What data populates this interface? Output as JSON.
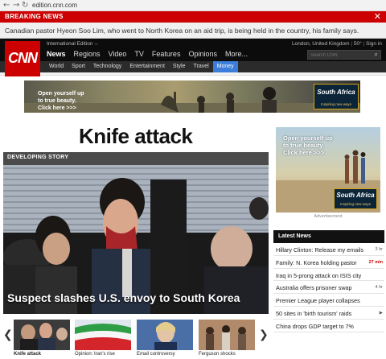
{
  "browser": {
    "back": "←",
    "forward": "→",
    "reload": "↻",
    "url": "edition.cnn.com"
  },
  "breaking": {
    "label": "BREAKING NEWS",
    "close": "✕",
    "text": "Canadian pastor Hyeon Soo Lim, who went to North Korea on an aid trip, is being held in the country, his family says."
  },
  "header": {
    "logo": "CNN",
    "edition": "International Edition ⌵",
    "location": "London, United Kingdom",
    "temp": "50°",
    "signin": "Sign in",
    "search_placeholder": "Search CNN",
    "search_icon": "search-icon",
    "nav": [
      "News",
      "Regions",
      "Video",
      "TV",
      "Features",
      "Opinions",
      "More..."
    ],
    "subnav": [
      "World",
      "Sport",
      "Technology",
      "Entertainment",
      "Style",
      "Travel",
      "Money"
    ]
  },
  "ad_top": {
    "text": "Open yourself up\nto true beauty.\nClick here >>>",
    "brand": "South Africa",
    "tagline": "Inspiring new ways"
  },
  "main": {
    "headline": "Knife attack",
    "story_label": "DEVELOPING STORY",
    "caption": "Suspect slashes U.S. envoy to South Korea"
  },
  "ad_right": {
    "text": "Open yourself up\nto true beauty.\nClick here >>>",
    "brand": "South Africa",
    "tagline": "Inspiring new ways",
    "label": "Advertisement"
  },
  "latest": {
    "title": "Latest News",
    "items": [
      {
        "text": "Hillary Clinton: Release my emails",
        "meta": "3 hr"
      },
      {
        "text": "Family: N. Korea holding pastor",
        "meta": "27 min"
      },
      {
        "text": "Iraq in 5-prong attack on ISIS city",
        "meta": ""
      },
      {
        "text": "Australia offers prisoner swap",
        "meta": "4 hr"
      },
      {
        "text": "Premier League player collapses",
        "meta": ""
      },
      {
        "text": "50 sites in 'birth tourism' raids",
        "meta": "▶"
      },
      {
        "text": "China drops GDP target to 7%",
        "meta": ""
      }
    ]
  },
  "carousel": {
    "prev": "❮",
    "next": "❯",
    "items": [
      {
        "caption": "Knife attack"
      },
      {
        "caption": "Opinion: Iran's rise"
      },
      {
        "caption": "Email controversy"
      },
      {
        "caption": "Ferguson shocks"
      }
    ]
  },
  "colors": {
    "brand_red": "#cc0000",
    "active_tab": "#3b7dd8"
  }
}
